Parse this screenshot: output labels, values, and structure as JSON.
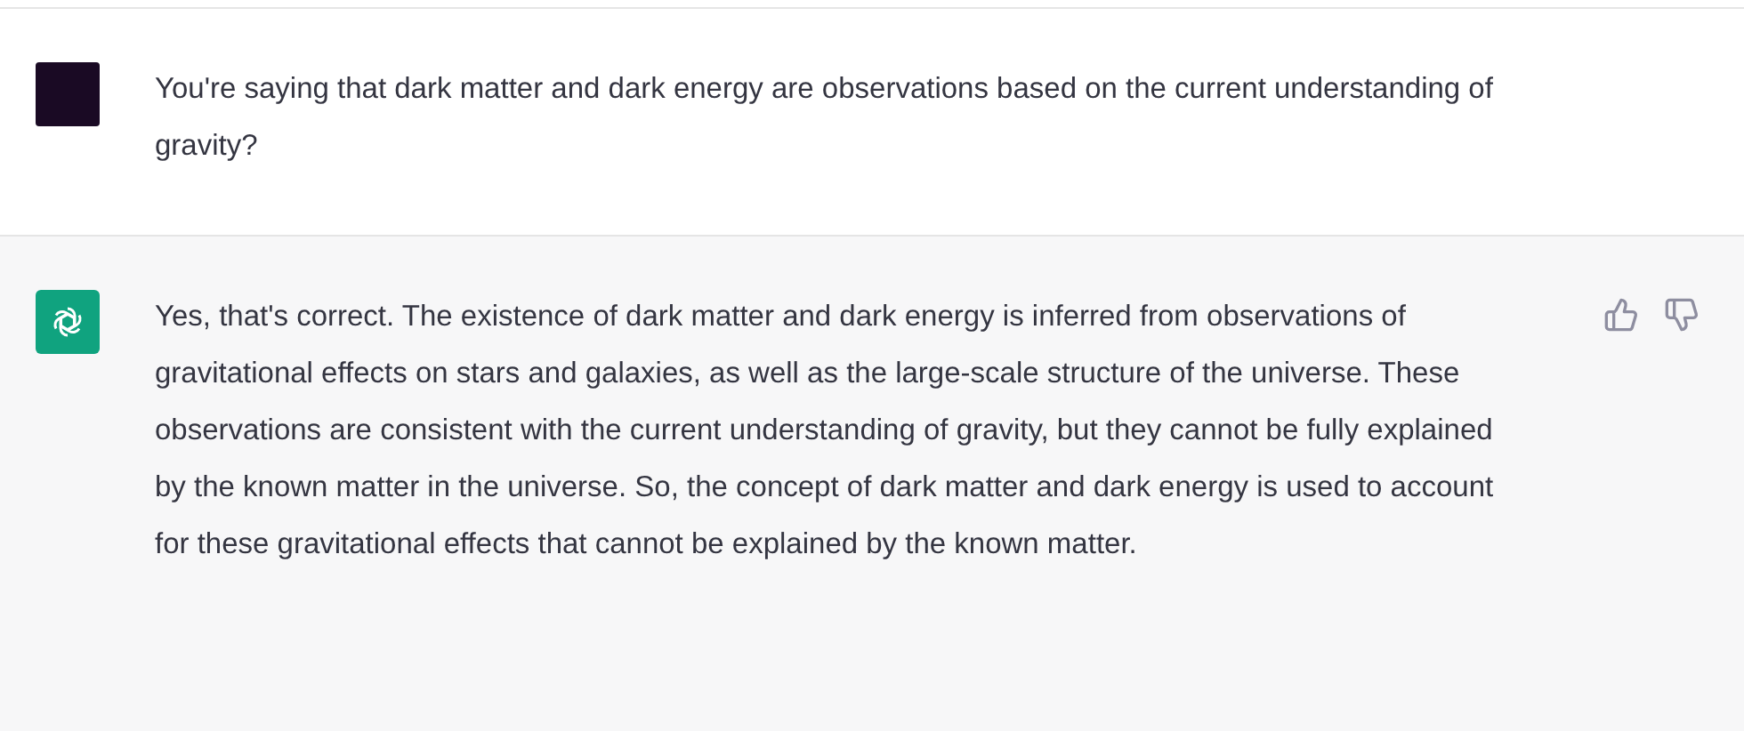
{
  "messages": [
    {
      "kind": "user",
      "text": "You're saying that dark matter and dark energy are observations based on the current understanding of gravity?"
    },
    {
      "kind": "assistant",
      "text": "Yes, that's correct. The existence of dark matter and dark energy is inferred from observations of gravitational effects on stars and galaxies, as well as the large-scale structure of the universe. These observations are consistent with the current understanding of gravity, but they cannot be fully explained by the known matter in the universe. So, the concept of dark matter and dark energy is used to account for these gravitational effects that cannot be explained by the known matter."
    }
  ]
}
